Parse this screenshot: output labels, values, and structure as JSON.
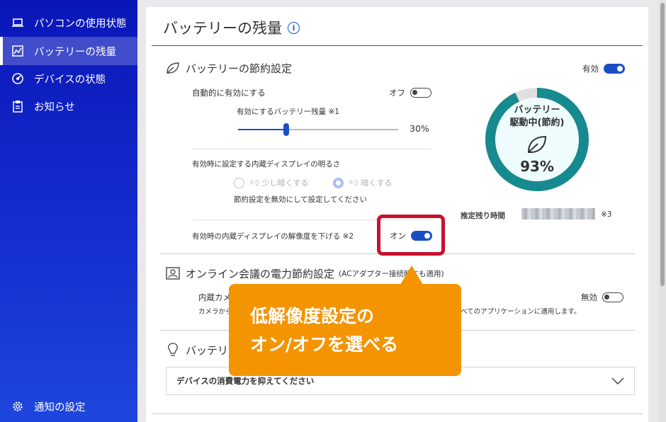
{
  "sidebar": {
    "items": [
      {
        "label": "パソコンの使用状態",
        "icon": "laptop-icon"
      },
      {
        "label": "バッテリーの残量",
        "icon": "battery-chart-icon",
        "active": true
      },
      {
        "label": "デバイスの状態",
        "icon": "gauge-icon"
      },
      {
        "label": "お知らせ",
        "icon": "clipboard-icon"
      }
    ],
    "footer": {
      "label": "通知の設定",
      "icon": "gear-icon"
    }
  },
  "page": {
    "title": "バッテリーの残量"
  },
  "saving": {
    "title": "バッテリーの節約設定",
    "toggle_label": "有効",
    "toggle_on": true,
    "auto": {
      "label": "自動的に有効にする",
      "toggle_label": "オフ",
      "toggle_on": false
    },
    "threshold": {
      "label": "有効にするバッテリー残量 ※1",
      "value_text": "30%",
      "value": 30
    },
    "brightness": {
      "label": "有効時に設定する内蔵ディスプレイの明るさ",
      "options": [
        "少し暗くする",
        "暗くする"
      ],
      "note": "節約設定を無効にして設定してください"
    },
    "resolution": {
      "label": "有効時の内蔵ディスプレイの解像度を下げる ※2",
      "toggle_label": "オン",
      "toggle_on": true
    },
    "gauge": {
      "line1": "バッテリー",
      "line2": "駆動中(節約)",
      "percent_text": "93%",
      "percent": 93,
      "color": "#168a8e",
      "track_color": "#e0e0e0"
    },
    "remaining": {
      "label": "推定残り時間",
      "note": "※3"
    }
  },
  "meeting": {
    "title": "オンライン会議の電力節約設定",
    "subtitle": "(ACアダプター接続時にも適用)",
    "camera_label": "内蔵カメ",
    "camera_desc_left": "カメラから",
    "camera_desc_right": "べてのアプリケーションに適用します。",
    "toggle_label": "無効",
    "toggle_on": false
  },
  "tips": {
    "title": "バッテリ",
    "dropdown_label": "デバイスの消費電力を抑えてください"
  },
  "callout": {
    "line1": "低解像度設定の",
    "line2": "オン/オフを選べる",
    "color": "#f39400"
  },
  "highlight_color": "#c8102e"
}
